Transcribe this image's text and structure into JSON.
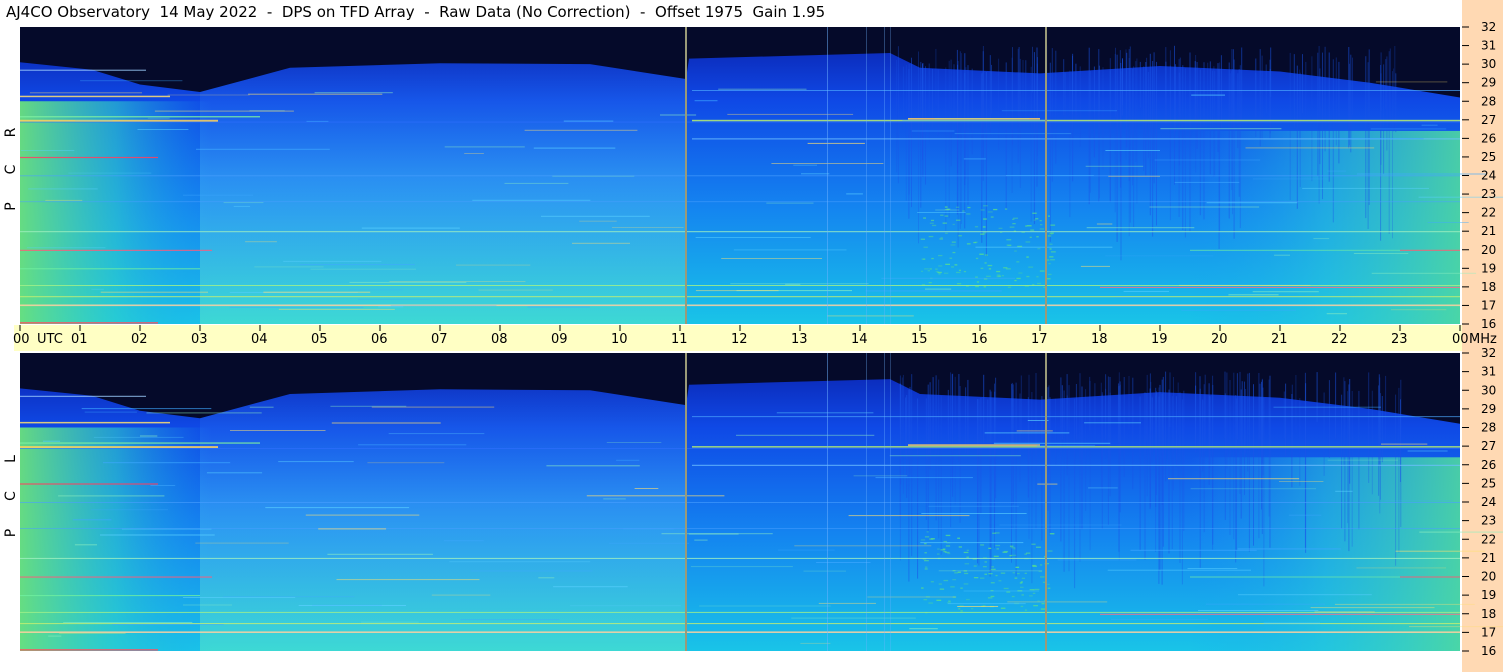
{
  "title": "AJ4CO Observatory  14 May 2022  -  DPS on TFD Array  -  Raw Data (No Correction)  -  Offset 1975  Gain 1.95",
  "colors": {
    "background": "#ffffff",
    "time_band": "#ffffc4",
    "freq_band": "#ffd9b3",
    "sky_dark": "#050a2a",
    "sky_blue": "#0f49e6",
    "sky_cyan": "#18b4f0",
    "sky_green": "#58e08c",
    "marker": "#9a9a78"
  },
  "chart_data": [
    {
      "type": "heatmap",
      "panel": "RCP",
      "side_label": [
        "R",
        "C",
        "P"
      ],
      "x": {
        "unit": "UTC",
        "range": [
          0,
          24
        ]
      },
      "y": {
        "unit": "MHz",
        "range": [
          16,
          32
        ],
        "ticks": [
          "16",
          "17",
          "18",
          "19",
          "20",
          "21",
          "22",
          "23",
          "24",
          "25",
          "26",
          "27",
          "28",
          "29",
          "30",
          "31",
          "32"
        ]
      },
      "vertical_markers_utc": [
        11.1,
        17.1
      ],
      "grid": false
    },
    {
      "type": "heatmap",
      "panel": "LCP",
      "side_label": [
        "L",
        "C",
        "P"
      ],
      "x": {
        "unit": "UTC",
        "range": [
          0,
          24
        ]
      },
      "y": {
        "unit": "MHz",
        "range": [
          16,
          32
        ],
        "ticks": [
          "16",
          "17",
          "18",
          "19",
          "20",
          "21",
          "22",
          "23",
          "24",
          "25",
          "26",
          "27",
          "28",
          "29",
          "30",
          "31",
          "32"
        ]
      },
      "vertical_markers_utc": [
        11.1,
        17.1
      ],
      "grid": false
    }
  ],
  "time_axis": {
    "ticks": [
      "00",
      "01",
      "02",
      "03",
      "04",
      "05",
      "06",
      "07",
      "08",
      "09",
      "10",
      "11",
      "12",
      "13",
      "14",
      "15",
      "16",
      "17",
      "18",
      "19",
      "20",
      "21",
      "22",
      "23",
      "00"
    ],
    "unit": "UTC",
    "freq_unit": "MHz"
  }
}
